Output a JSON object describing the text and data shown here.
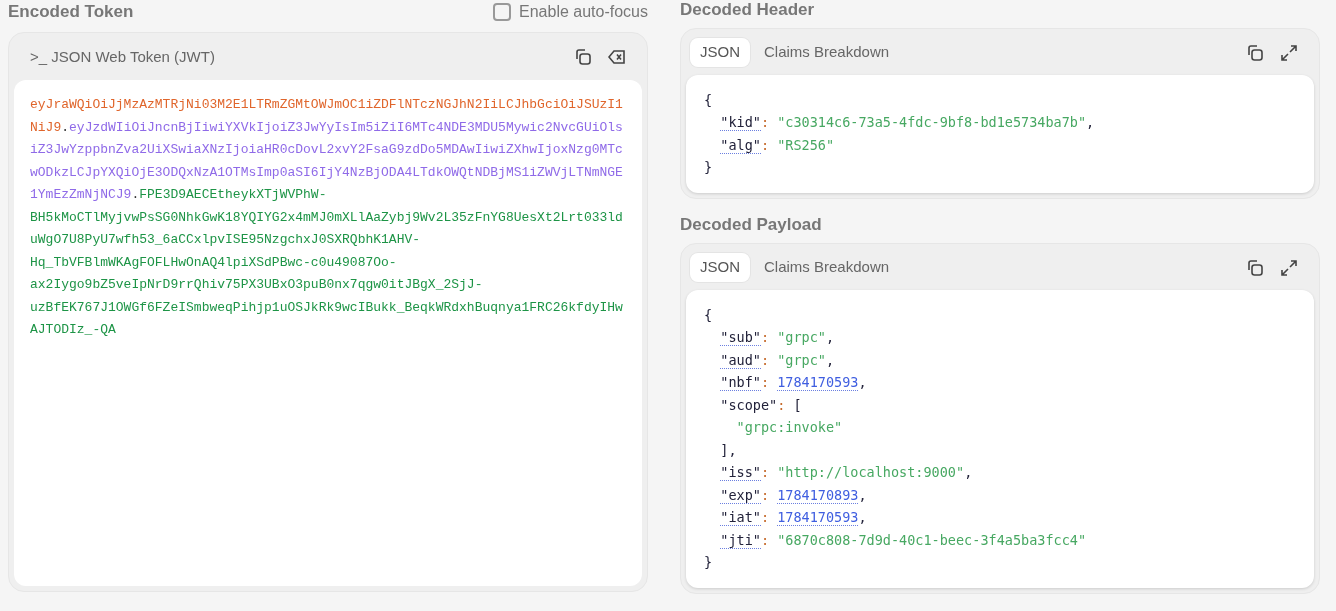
{
  "encoded": {
    "heading": "Encoded Token",
    "autofocus": {
      "label": "Enable auto-focus",
      "checked": false
    },
    "title_prompt": ">_",
    "title": "JSON Web Token (JWT)",
    "token": [
      {
        "kind": "header",
        "text": "eyJraWQiOiJjMzAzMTRjNi03M2E1LTRmZGMtOWJmOC1iZDFlNTczNGJhN2IiLCJhbGciOiJSUzI1NiJ9"
      },
      {
        "kind": "dot",
        "text": "."
      },
      {
        "kind": "payload",
        "text": "eyJzdWIiOiJncnBjIiwiYXVkIjoiZ3JwYyIsIm5iZiI6MTc4NDE3MDU5Mywic2NvcGUiOlsiZ3JwYzppbnZva2UiXSwiaXNzIjoiaHR0cDovL2xvY2FsaG9zdDo5MDAwIiwiZXhwIjoxNzg0MTcwODkzLCJpYXQiOjE3ODQxNzA1OTMsImp0aSI6IjY4NzBjODA4LTdkOWQtNDBjMS1iZWVjLTNmNGE1YmEzZmNjNCJ9"
      },
      {
        "kind": "dot",
        "text": "."
      },
      {
        "kind": "signature",
        "text": "FPE3D9AECEtheykXTjWVPhW-BH5kMoCTlMyjvwPsSG0NhkGwK18YQIYG2x4mMJ0mXLlAaZybj9Wv2L35zFnYG8UesXt2Lrt033lduWgO7U8PyU7wfh53_6aCCxlpvISE95NzgchxJ0SXRQbhK1AHV-Hq_TbVFBlmWKAgFOFLHwOnAQ4lpiXSdPBwc-c0u49087Oo-ax2Iygo9bZ5veIpNrD9rrQhiv75PX3UBxO3puB0nx7qgw0itJBgX_2SjJ-uzBfEK767J1OWGf6FZeISmbweqPihjp1uOSJkRk9wcIBukk_BeqkWRdxhBuqnya1FRC26kfdyIHwAJTODIz_-QA"
      }
    ]
  },
  "panels": [
    {
      "heading": "Decoded Header",
      "tabs": [
        {
          "label": "JSON",
          "selected": true
        },
        {
          "label": "Claims Breakdown",
          "selected": false
        }
      ],
      "open": "{",
      "close": "}",
      "claims": [
        {
          "key": "\"kid\"",
          "sep": ":",
          "hint": true,
          "kind": "string",
          "value": "\"c30314c6-73a5-4fdc-9bf8-bd1e5734ba7b\"",
          "comma": ","
        },
        {
          "key": "\"alg\"",
          "sep": ":",
          "hint": true,
          "kind": "string",
          "value": "\"RS256\""
        }
      ]
    },
    {
      "heading": "Decoded Payload",
      "tabs": [
        {
          "label": "JSON",
          "selected": true
        },
        {
          "label": "Claims Breakdown",
          "selected": false
        }
      ],
      "open": "{",
      "close": "}",
      "claims": [
        {
          "key": "\"sub\"",
          "sep": ":",
          "hint": true,
          "kind": "string",
          "value": "\"grpc\"",
          "comma": ","
        },
        {
          "key": "\"aud\"",
          "sep": ":",
          "hint": true,
          "kind": "string",
          "value": "\"grpc\"",
          "comma": ","
        },
        {
          "key": "\"nbf\"",
          "sep": ":",
          "hint": true,
          "kind": "number",
          "value": "1784170593",
          "comma": ","
        },
        {
          "key": "\"scope\"",
          "sep": ":",
          "hint": false,
          "kind": "array",
          "open": "[",
          "close": "],",
          "items": [
            "\"grpc:invoke\""
          ]
        },
        {
          "key": "\"iss\"",
          "sep": ":",
          "hint": true,
          "kind": "string",
          "value": "\"http://localhost:9000\"",
          "comma": ","
        },
        {
          "key": "\"exp\"",
          "sep": ":",
          "hint": true,
          "kind": "number",
          "value": "1784170893",
          "comma": ","
        },
        {
          "key": "\"iat\"",
          "sep": ":",
          "hint": true,
          "kind": "number",
          "value": "1784170593",
          "comma": ","
        },
        {
          "key": "\"jti\"",
          "sep": ":",
          "hint": true,
          "kind": "string",
          "value": "\"6870c808-7d9d-40c1-beec-3f4a5ba3fcc4\""
        }
      ]
    }
  ]
}
